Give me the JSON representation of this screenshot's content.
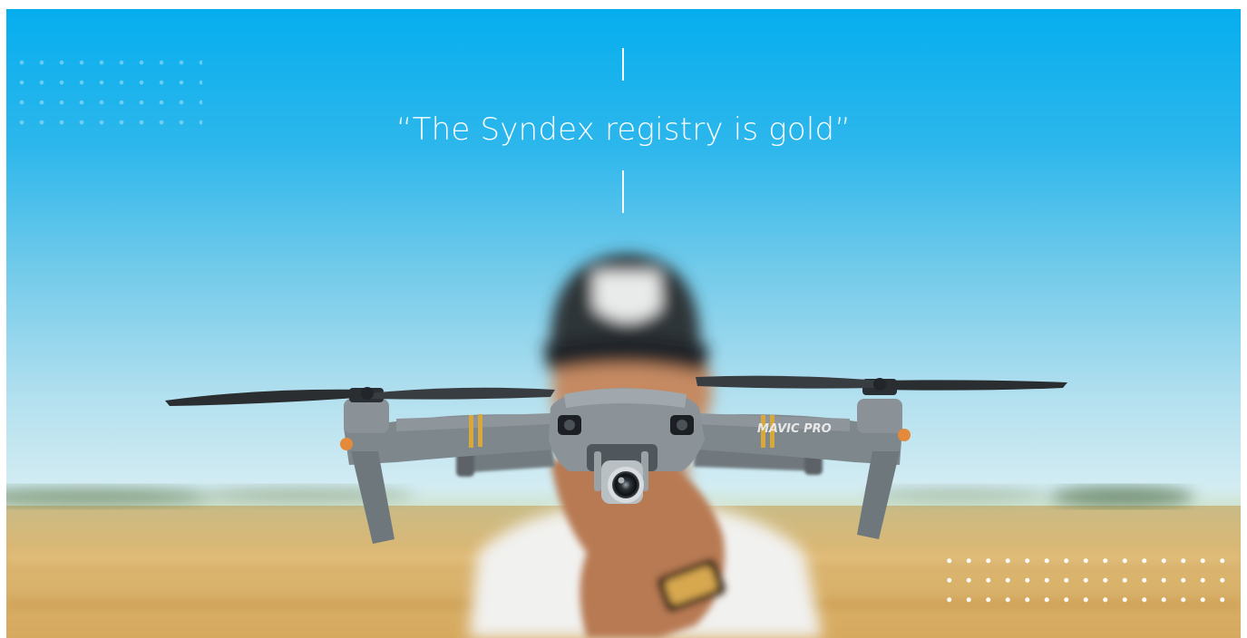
{
  "hero": {
    "quote": "“The Syndex registry is gold”",
    "drone_brand": "MAVIC PRO"
  },
  "colors": {
    "sky_top": "#06aeee",
    "sky_mid": "#5fc4ea",
    "sky_horizon": "#cfe9f3",
    "field": "#d9b46f",
    "accent_gold": "#d8a83a"
  },
  "icons": [
    "drone",
    "camera-gimbal",
    "propeller",
    "dot-grid"
  ]
}
